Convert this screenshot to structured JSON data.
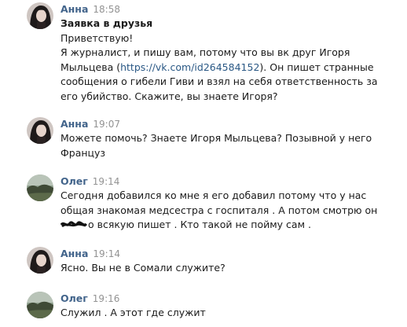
{
  "messages": [
    {
      "author": "Анна",
      "time": "18:58",
      "avatar": "female-user-avatar",
      "title": "Заявка в друзья",
      "lines": [
        "Приветствую!",
        "Я журналист, и пишу вам, потому что вы вк друг Игоря",
        "сообщения о гибели Гиви и взял на себя ответственность за",
        "его убийство. Скажите, вы знаете Игоря?"
      ],
      "line3_prefix": "Мыльцева (",
      "link": "https://vk.com/id264584152",
      "line3_suffix": "). Он пишет странные"
    },
    {
      "author": "Анна",
      "time": "19:07",
      "avatar": "female-user-avatar",
      "lines": [
        "Можете помочь? Знаете Игоря Мыльцева? Позывной у него",
        "Француз"
      ]
    },
    {
      "author": "Олег",
      "time": "19:14",
      "avatar": "landscape-avatar",
      "lines": [
        "Сегодня добавился ко мне я его добавил потому что у нас",
        "общая знакомая медсестра с госпиталя . А потом смотрю он",
        "о всякую пишет . Кто такой не пойму сам ."
      ]
    },
    {
      "author": "Анна",
      "time": "19:14",
      "avatar": "female-user-avatar",
      "lines": [
        "Ясно. Вы не в Сомали служите?"
      ]
    },
    {
      "author": "Олег",
      "time": "19:16",
      "avatar": "landscape-avatar",
      "lines": [
        "Служил . А этот где служит"
      ]
    }
  ],
  "colors": {
    "author": "#42648b",
    "time": "#939393",
    "text": "#1a1a1a",
    "link": "#2a5885"
  }
}
